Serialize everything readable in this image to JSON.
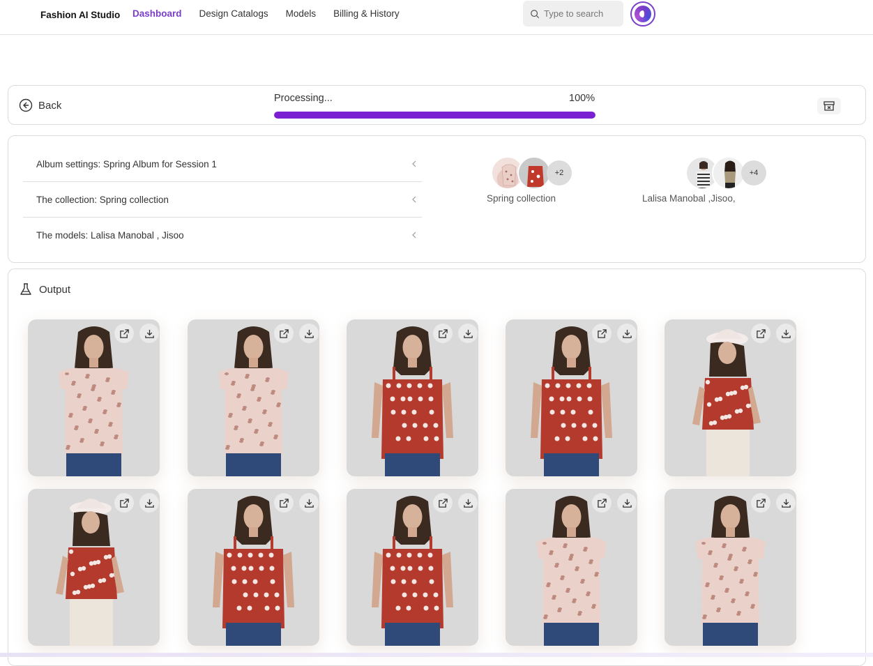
{
  "app": {
    "brand": "Fashion AI Studio",
    "nav": [
      {
        "label": "Dashboard",
        "active": true
      },
      {
        "label": "Design Catalogs",
        "active": false
      },
      {
        "label": "Models",
        "active": false
      },
      {
        "label": "Billing & History",
        "active": false
      }
    ],
    "search_placeholder": "Type to search",
    "accent_color": "#7a3ec7"
  },
  "progress": {
    "back_label": "Back",
    "status": "Processing...",
    "percent_text": "100%",
    "percent_value": 100,
    "bar_color": "#7a1fd1"
  },
  "settings": {
    "rows": [
      {
        "label": "Album settings: Spring Album for Session 1"
      },
      {
        "label": "The collection: Spring collection"
      },
      {
        "label": "The models: Lalisa Manobal , Jisoo"
      }
    ],
    "collection_group": {
      "label": "Spring collection",
      "more": "+2"
    },
    "models_group": {
      "label": "Lalisa Manobal ,Jisoo,",
      "more": "+4"
    }
  },
  "output": {
    "title": "Output",
    "images": [
      {
        "top": "leopard"
      },
      {
        "top": "leopard"
      },
      {
        "top": "red-floral"
      },
      {
        "top": "red-floral"
      },
      {
        "top": "red-floral-hat"
      },
      {
        "top": "red-floral-hat"
      },
      {
        "top": "red-floral"
      },
      {
        "top": "red-floral"
      },
      {
        "top": "leopard"
      },
      {
        "top": "leopard"
      }
    ]
  }
}
